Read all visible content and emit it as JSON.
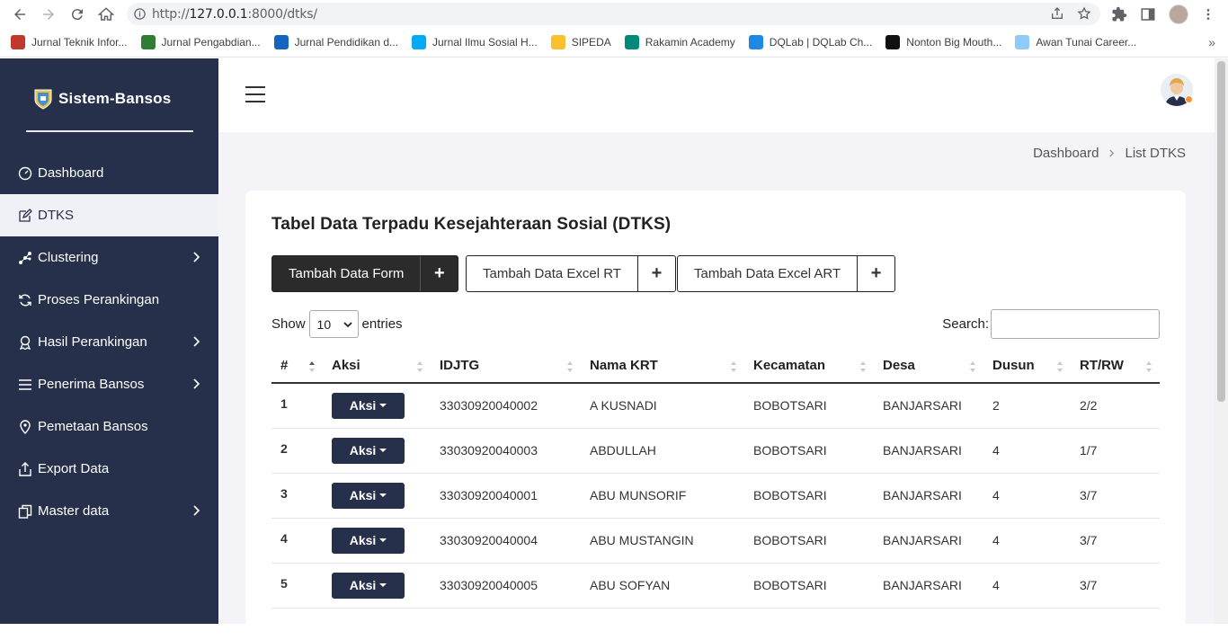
{
  "browser": {
    "url_host": "127.0.0.1",
    "url_rest": ":8000/dtks/",
    "url_prefix": "http://",
    "bookmarks": [
      {
        "label": "Jurnal Teknik Infor...",
        "color": "#c0392b"
      },
      {
        "label": "Jurnal Pengabdian...",
        "color": "#2e7d32"
      },
      {
        "label": "Jurnal Pendidikan d...",
        "color": "#1565c0"
      },
      {
        "label": "Jurnal Ilmu Sosial H...",
        "color": "#03a9f4"
      },
      {
        "label": "SIPEDA",
        "color": "#fbc02d"
      },
      {
        "label": "Rakamin Academy",
        "color": "#00897b"
      },
      {
        "label": "DQLab | DQLab Ch...",
        "color": "#1e88e5"
      },
      {
        "label": "Nonton Big Mouth...",
        "color": "#111111"
      },
      {
        "label": "Awan Tunai Career...",
        "color": "#90caf9"
      }
    ]
  },
  "sidebar": {
    "brand": "Sistem-Bansos",
    "items": [
      {
        "label": "Dashboard",
        "icon": "gauge-icon",
        "active": false,
        "chevron": false
      },
      {
        "label": "DTKS",
        "icon": "edit-icon",
        "active": true,
        "chevron": false
      },
      {
        "label": "Clustering",
        "icon": "cluster-icon",
        "active": false,
        "chevron": true
      },
      {
        "label": "Proses Perankingan",
        "icon": "sync-icon",
        "active": false,
        "chevron": false
      },
      {
        "label": "Hasil Perankingan",
        "icon": "award-icon",
        "active": false,
        "chevron": true
      },
      {
        "label": "Penerima Bansos",
        "icon": "list-icon",
        "active": false,
        "chevron": true
      },
      {
        "label": "Pemetaan Bansos",
        "icon": "map-pin-icon",
        "active": false,
        "chevron": false
      },
      {
        "label": "Export Data",
        "icon": "export-icon",
        "active": false,
        "chevron": false
      },
      {
        "label": "Master data",
        "icon": "copy-icon",
        "active": false,
        "chevron": true
      }
    ]
  },
  "breadcrumb": {
    "home": "Dashboard",
    "current": "List DTKS"
  },
  "card": {
    "title": "Tabel Data Terpadu Kesejahteraan Sosial (DTKS)",
    "buttons": {
      "form": "Tambah Data Form",
      "excel_rt": "Tambah Data Excel RT",
      "excel_art": "Tambah Data Excel ART",
      "plus": "+"
    },
    "show_label": "Show",
    "entries_value": "10",
    "entries_label": "entries",
    "search_label": "Search:",
    "search_value": ""
  },
  "table": {
    "headers": [
      "#",
      "Aksi",
      "IDJTG",
      "Nama KRT",
      "Kecamatan",
      "Desa",
      "Dusun",
      "RT/RW"
    ],
    "action_label": "Aksi",
    "rows": [
      {
        "no": "1",
        "idjtg": "33030920040002",
        "nama": "A KUSNADI",
        "kecamatan": "BOBOTSARI",
        "desa": "BANJARSARI",
        "dusun": "2",
        "rtrw": "2/2"
      },
      {
        "no": "2",
        "idjtg": "33030920040003",
        "nama": "ABDULLAH",
        "kecamatan": "BOBOTSARI",
        "desa": "BANJARSARI",
        "dusun": "4",
        "rtrw": "1/7"
      },
      {
        "no": "3",
        "idjtg": "33030920040001",
        "nama": "ABU MUNSORIF",
        "kecamatan": "BOBOTSARI",
        "desa": "BANJARSARI",
        "dusun": "4",
        "rtrw": "3/7"
      },
      {
        "no": "4",
        "idjtg": "33030920040004",
        "nama": "ABU MUSTANGIN",
        "kecamatan": "BOBOTSARI",
        "desa": "BANJARSARI",
        "dusun": "4",
        "rtrw": "3/7"
      },
      {
        "no": "5",
        "idjtg": "33030920040005",
        "nama": "ABU SOFYAN",
        "kecamatan": "BOBOTSARI",
        "desa": "BANJARSARI",
        "dusun": "4",
        "rtrw": "3/7"
      }
    ]
  }
}
